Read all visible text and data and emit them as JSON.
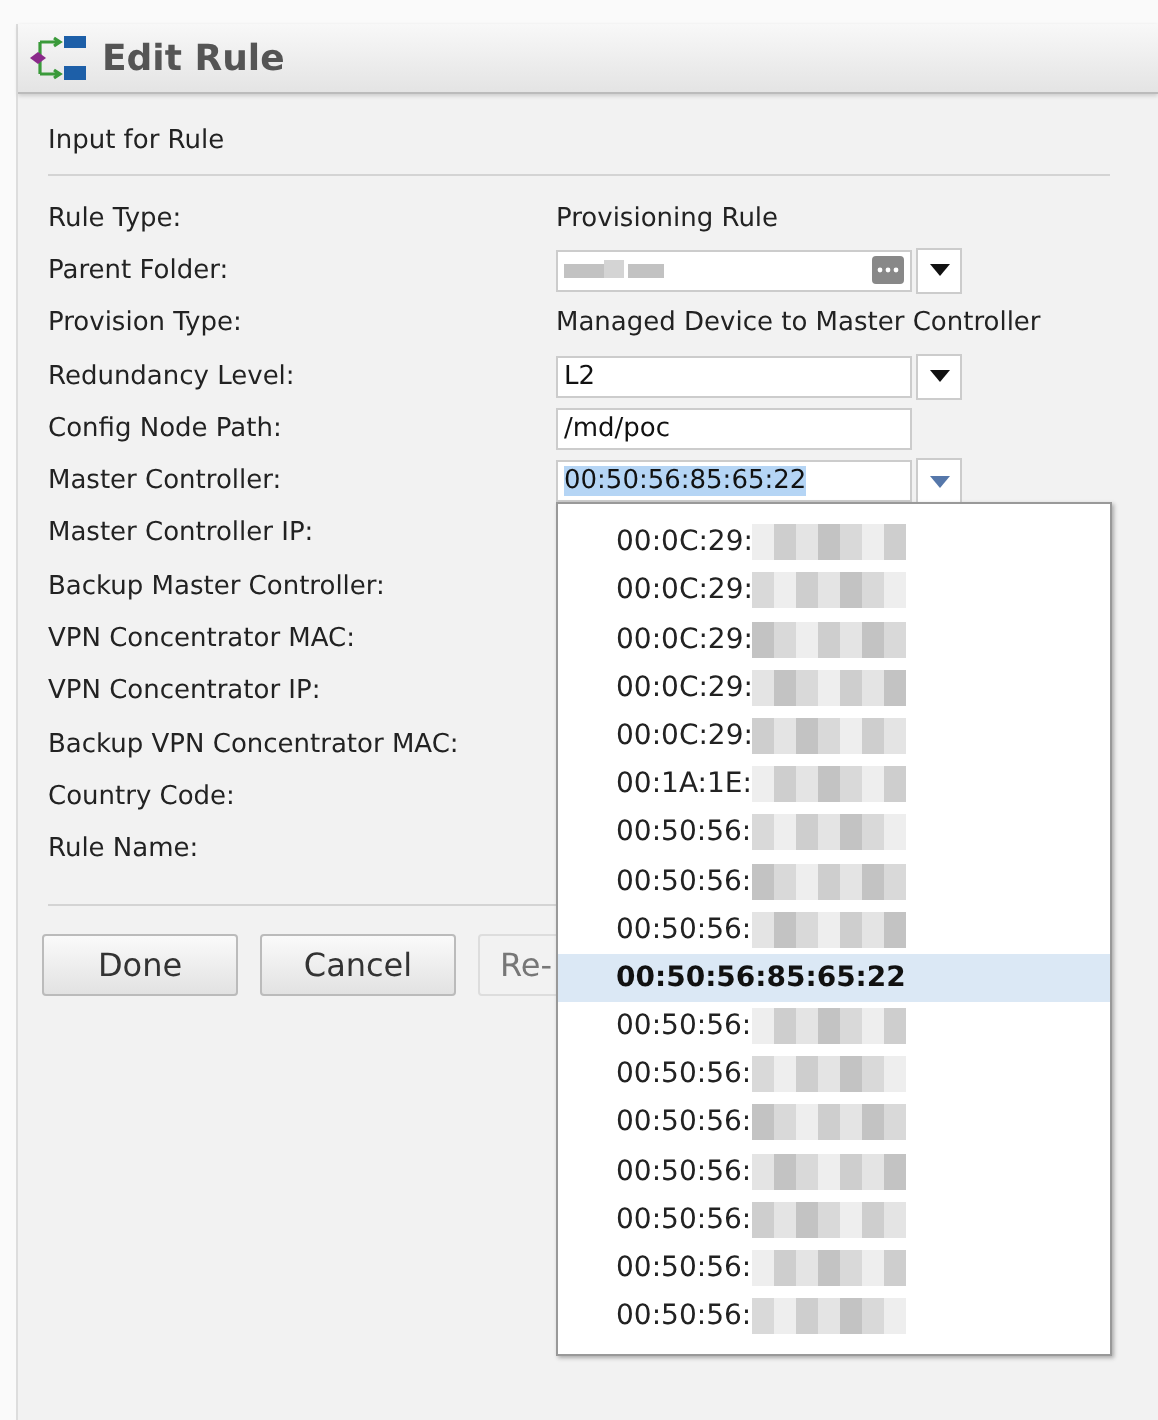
{
  "title": "Edit Rule",
  "section": "Input for Rule",
  "fields": [
    {
      "label": "Rule Type:",
      "kind": "static",
      "value": "Provisioning Rule"
    },
    {
      "label": "Parent Folder:",
      "kind": "folder",
      "redacted": true
    },
    {
      "label": "Provision Type:",
      "kind": "static",
      "value": "Managed Device to Master Controller"
    },
    {
      "label": "Redundancy Level:",
      "kind": "select",
      "value": "L2",
      "focused": false
    },
    {
      "label": "Config Node Path:",
      "kind": "text",
      "value": "/md/poc"
    },
    {
      "label": "Master Controller:",
      "kind": "select",
      "value": "00:50:56:85:65:22",
      "focused": true
    },
    {
      "label": "Master Controller IP:",
      "kind": "empty"
    },
    {
      "label": "Backup Master Controller:",
      "kind": "empty"
    },
    {
      "label": "VPN Concentrator MAC:",
      "kind": "empty"
    },
    {
      "label": "VPN Concentrator IP:",
      "kind": "empty"
    },
    {
      "label": "Backup VPN Concentrator MAC:",
      "kind": "empty"
    },
    {
      "label": "Country Code:",
      "kind": "empty"
    },
    {
      "label": "Rule Name:",
      "kind": "empty"
    }
  ],
  "dropdown": {
    "options": [
      {
        "label": "00:0C:29:",
        "redacted": true,
        "selected": false
      },
      {
        "label": "00:0C:29:",
        "redacted": true,
        "selected": false
      },
      {
        "label": "00:0C:29:",
        "redacted": true,
        "selected": false
      },
      {
        "label": "00:0C:29:",
        "redacted": true,
        "selected": false
      },
      {
        "label": "00:0C:29:",
        "redacted": true,
        "selected": false
      },
      {
        "label": "00:1A:1E:",
        "redacted": true,
        "selected": false
      },
      {
        "label": "00:50:56:",
        "redacted": true,
        "selected": false
      },
      {
        "label": "00:50:56:",
        "redacted": true,
        "selected": false
      },
      {
        "label": "00:50:56:",
        "redacted": true,
        "selected": false
      },
      {
        "label": "00:50:56:85:65:22",
        "redacted": false,
        "selected": true
      },
      {
        "label": "00:50:56:",
        "redacted": true,
        "selected": false
      },
      {
        "label": "00:50:56:",
        "redacted": true,
        "selected": false
      },
      {
        "label": "00:50:56:",
        "redacted": true,
        "selected": false
      },
      {
        "label": "00:50:56:",
        "redacted": true,
        "selected": false
      },
      {
        "label": "00:50:56:",
        "redacted": true,
        "selected": false
      },
      {
        "label": "00:50:56:",
        "redacted": true,
        "selected": false
      },
      {
        "label": "00:50:56:",
        "redacted": true,
        "selected": false
      }
    ]
  },
  "buttons": [
    {
      "label": "Done",
      "disabled": false
    },
    {
      "label": "Cancel",
      "disabled": false
    },
    {
      "label": "Re-",
      "disabled": true
    }
  ]
}
